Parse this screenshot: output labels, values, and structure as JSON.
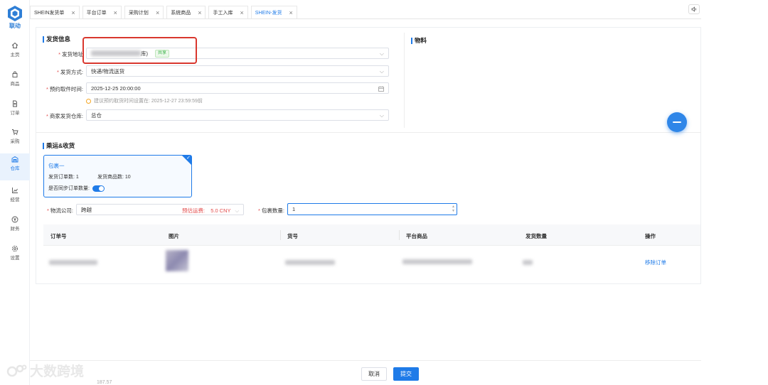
{
  "app": {
    "logo_text": "联动"
  },
  "sidebar": {
    "items": [
      {
        "label": "主页",
        "icon": "home-icon"
      },
      {
        "label": "商品",
        "icon": "bag-icon"
      },
      {
        "label": "订单",
        "icon": "document-icon"
      },
      {
        "label": "采购",
        "icon": "cart-icon"
      },
      {
        "label": "仓库",
        "icon": "warehouse-icon",
        "active": true
      },
      {
        "label": "经营",
        "icon": "chart-icon"
      },
      {
        "label": "财务",
        "icon": "yen-icon"
      },
      {
        "label": "设置",
        "icon": "gear-icon"
      }
    ]
  },
  "tabs": [
    {
      "label": "SHEIN发货单"
    },
    {
      "label": "平台订单"
    },
    {
      "label": "采购计划"
    },
    {
      "label": "系统商品"
    },
    {
      "label": "手工入库"
    },
    {
      "label": "SHEIN-发货",
      "active": true
    }
  ],
  "shipping_info": {
    "title": "发货信息",
    "address_label": "发货地址",
    "address_value_suffix": "库)",
    "address_tag": "共享",
    "method_label": "发货方式:",
    "method_value": "快递/物流送货",
    "pickup_label": "预约取件时间:",
    "pickup_value": "2025-12-25 20:00:00",
    "hint": "建议预约取货时间设置在: 2025-12-27 23:59:59前",
    "warehouse_label": "商家发货仓库:",
    "warehouse_value": "总仓"
  },
  "materials": {
    "title": "物料"
  },
  "carrier": {
    "title": "乘运&收货",
    "package": {
      "name": "包裹一",
      "order_count_label": "发货订单数: 1",
      "item_count_label": "发货商品数: 10",
      "sync_label": "是否同步订单数量:"
    },
    "logistics_label": "物流公司:",
    "logistics_value": "跨越",
    "freight_label": "预估运费:",
    "freight_value": "5.0 CNY",
    "package_count_label": "包裹数量:",
    "package_count_value": "1"
  },
  "table": {
    "headers": [
      "订单号",
      "图片",
      "货号",
      "平台商品",
      "发货数量",
      "操作"
    ],
    "row_action": "移除订单"
  },
  "footer": {
    "cancel": "取消",
    "submit": "提交"
  },
  "watermark": "大数跨境",
  "partial_text": "187.57",
  "colors": {
    "primary": "#1f7be8",
    "danger": "#e34d4d",
    "highlight_box": "#d9372e"
  }
}
